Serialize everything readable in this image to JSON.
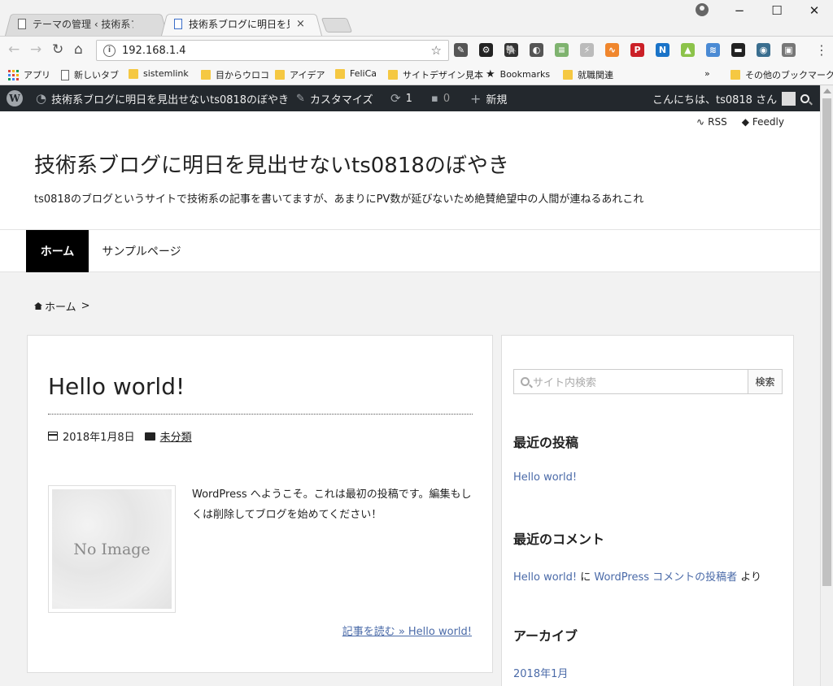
{
  "browser": {
    "tabs": [
      {
        "label": "テーマの管理 ‹ 技術系ブログ",
        "close": "×"
      },
      {
        "label": "技術系ブログに明日を見出せな",
        "close": "×"
      }
    ],
    "window_controls": {
      "minimize": "−",
      "maximize": "☐",
      "close": "✕"
    },
    "url": "192.168.1.4",
    "extensions": [
      {
        "name": "eyedropper-icon",
        "color": "#555555",
        "glyph": "✎"
      },
      {
        "name": "gear-ext-icon",
        "color": "#222222",
        "glyph": "⚙"
      },
      {
        "name": "evernote-icon",
        "color": "#333333",
        "glyph": "🐘"
      },
      {
        "name": "shield-ext-icon",
        "color": "#555555",
        "glyph": "◐"
      },
      {
        "name": "note-ext-icon",
        "color": "#7fb36f",
        "glyph": "≡"
      },
      {
        "name": "bolt-ext-icon",
        "color": "#bbbbbb",
        "glyph": "⚡"
      },
      {
        "name": "rss-ext-icon",
        "color": "#f0862d",
        "glyph": "∿"
      },
      {
        "name": "pinterest-icon",
        "color": "#cb2027",
        "glyph": "P"
      },
      {
        "name": "new-ext-icon",
        "color": "#1a73c8",
        "glyph": "N"
      },
      {
        "name": "android-icon",
        "color": "#8cc34a",
        "glyph": "▲"
      },
      {
        "name": "translate-ext-icon",
        "color": "#4a8ad4",
        "glyph": "≋"
      },
      {
        "name": "terminal-ext-icon",
        "color": "#222222",
        "glyph": "▬"
      },
      {
        "name": "eye-ext-icon",
        "color": "#3a6e8f",
        "glyph": "◉"
      },
      {
        "name": "image-ext-icon",
        "color": "#777777",
        "glyph": "▣"
      }
    ],
    "bookmarks": [
      {
        "label": "アプリ",
        "type": "apps"
      },
      {
        "label": "新しいタブ",
        "type": "page"
      },
      {
        "label": "sistemlink",
        "type": "folder"
      },
      {
        "label": "目からウロコ",
        "type": "folder"
      },
      {
        "label": "アイデア",
        "type": "folder"
      },
      {
        "label": "FeliCa",
        "type": "folder"
      },
      {
        "label": "サイトデザイン見本",
        "type": "folder"
      },
      {
        "label": "Bookmarks",
        "type": "star"
      },
      {
        "label": "就職関連",
        "type": "folder"
      }
    ],
    "bookmarks_more": "»",
    "other_bookmarks": "その他のブックマーク"
  },
  "adminbar": {
    "site_name": "技術系ブログに明日を見出せないts0818のぼやき",
    "customize": "カスタマイズ",
    "updates": "1",
    "comments": "0",
    "new": "新規",
    "greeting": "こんにちは、ts0818 さん"
  },
  "site": {
    "top_links": {
      "rss": "RSS",
      "feedly": "Feedly"
    },
    "title": "技術系ブログに明日を見出せないts0818のぼやき",
    "description": "ts0818のブログというサイトで技術系の記事を書いてますが、あまりにPV数が延びないため絶賛絶望中の人間が連ねるあれこれ",
    "nav": [
      {
        "label": "ホーム"
      },
      {
        "label": "サンプルページ"
      }
    ],
    "breadcrumb": {
      "home": "ホーム",
      "sep": ">"
    }
  },
  "post": {
    "title": "Hello world!",
    "date": "2018年1月8日",
    "category": "未分類",
    "thumbnail_text": "No Image",
    "excerpt": "WordPress へようこそ。これは最初の投稿です。編集もしくは削除してブログを始めてください！",
    "read_more": "記事を読む »  Hello world!"
  },
  "sidebar": {
    "search_placeholder": "サイト内検索",
    "search_button": "検索",
    "recent_posts_title": "最近の投稿",
    "recent_posts": [
      "Hello world!"
    ],
    "recent_comments_title": "最近のコメント",
    "recent_comment": {
      "post": "Hello world!",
      "mid": " に ",
      "author": "WordPress コメントの投稿者",
      "tail": " より"
    },
    "archives_title": "アーカイブ",
    "archives": [
      "2018年1月"
    ]
  }
}
